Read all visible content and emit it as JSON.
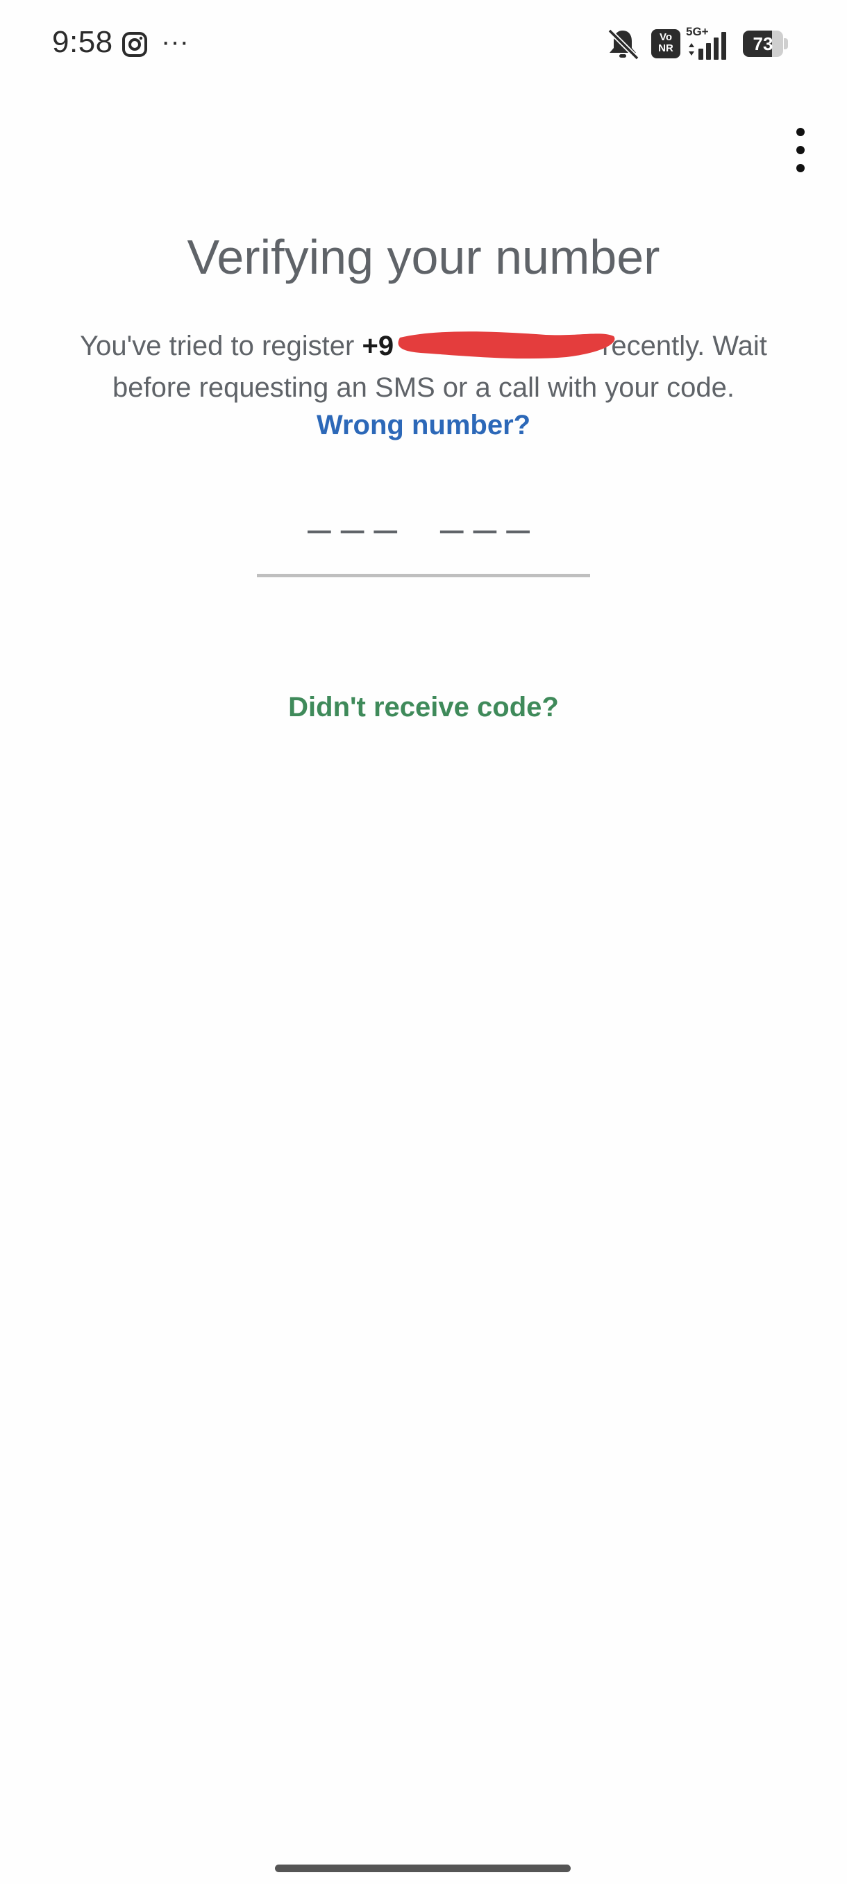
{
  "status_bar": {
    "time": "9:58",
    "more_notifications": "···",
    "network": "5G+",
    "vonr": "Vo\nNR",
    "battery_level": "73",
    "battery_fraction": 0.73
  },
  "header": {
    "title": "Verifying your number"
  },
  "message": {
    "before": "You've tried to register ",
    "phone_visible": "+9",
    "after": "recently. Wait before requesting an SMS or a call with your code."
  },
  "links": {
    "wrong_number": "Wrong number?",
    "resend": "Didn't receive code?"
  },
  "code_input": {
    "placeholder": "––– –––"
  },
  "colors": {
    "link_blue": "#2c68b8",
    "link_green": "#3f8a5a",
    "redaction": "#e43d3d",
    "text_gray": "#5f6368"
  },
  "icons": {
    "status": [
      "instagram-icon",
      "more-notifications-icon",
      "mute-icon",
      "signal-icon",
      "battery-icon"
    ],
    "menu": "overflow-menu-icon"
  }
}
